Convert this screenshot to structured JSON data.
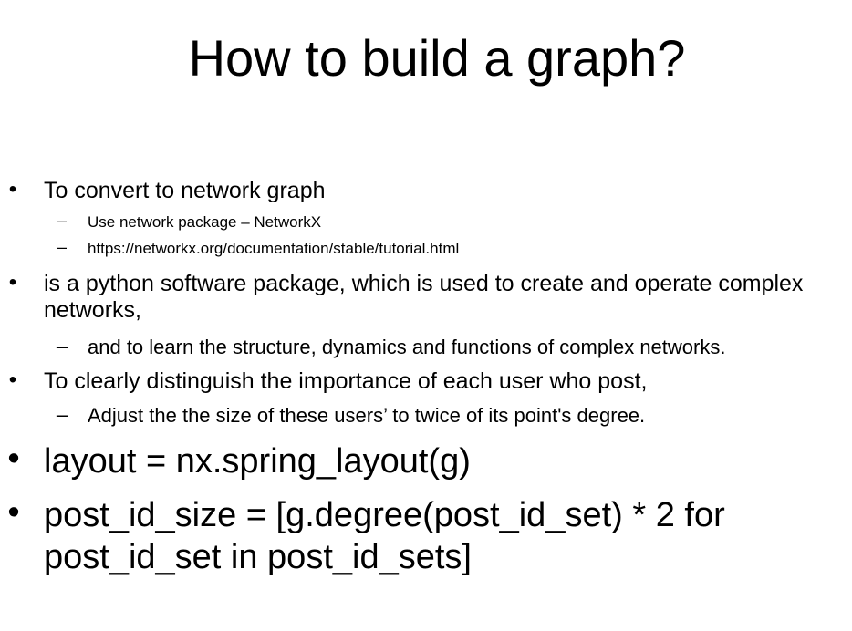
{
  "slide": {
    "title": "How to build a graph?",
    "bullet_glyph": "•",
    "dash_glyph": "–",
    "items": [
      {
        "text": "To convert to network graph"
      },
      {
        "text": "Use network package – NetworkX"
      },
      {
        "text": "https://networkx.org/documentation/stable/tutorial.html"
      },
      {
        "line1": "is a python software package, which is used to create and operate complex",
        "line2": "networks,"
      },
      {
        "text": "and to learn the structure, dynamics and functions of complex networks."
      },
      {
        "text": "To clearly distinguish the importance of each user who post,"
      },
      {
        "text": "Adjust the the size of these users’ to twice of its point's degree."
      },
      {
        "text": "layout = nx.spring_layout(g)"
      },
      {
        "line1": "post_id_size = [g.degree(post_id_set) * 2 for",
        "line2": "post_id_set in post_id_sets]"
      }
    ]
  }
}
